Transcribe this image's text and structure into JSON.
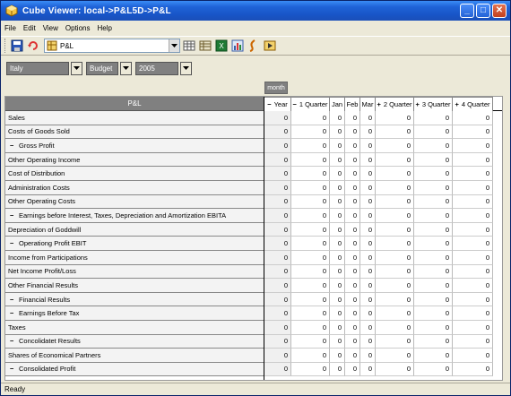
{
  "window": {
    "title": "Cube Viewer:  local->P&L5D->P&L",
    "controls": [
      "minimize",
      "maximize",
      "close"
    ]
  },
  "menu": [
    {
      "label": "File",
      "accel": "F"
    },
    {
      "label": "Edit",
      "accel": "E"
    },
    {
      "label": "View",
      "accel": "V"
    },
    {
      "label": "Options",
      "accel": "O"
    },
    {
      "label": "Help",
      "accel": "H"
    }
  ],
  "toolbar": {
    "cube_selected": "P&L",
    "icons": [
      "save-icon",
      "refresh-icon",
      "cube-icon",
      "table-icon",
      "grid-icon",
      "excel-icon",
      "chart-icon",
      "rule-icon",
      "export-icon"
    ]
  },
  "dimensions": [
    {
      "value": "Italy",
      "name": "country-select"
    },
    {
      "value": "Budget",
      "name": "version-select"
    },
    {
      "value": "2005",
      "name": "year-select"
    }
  ],
  "column_dimension": "month",
  "row_dimension_title": "P&L",
  "columns": [
    {
      "label": "Year",
      "expanded": true,
      "prefix": "−"
    },
    {
      "label": "1 Quarter",
      "expanded": true,
      "prefix": "−"
    },
    {
      "label": "Jan",
      "prefix": ""
    },
    {
      "label": "Feb",
      "prefix": ""
    },
    {
      "label": "Mar",
      "prefix": ""
    },
    {
      "label": "2 Quarter",
      "prefix": "+"
    },
    {
      "label": "3 Quarter",
      "prefix": "+"
    },
    {
      "label": "4 Quarter",
      "prefix": "+"
    }
  ],
  "rows": [
    {
      "label": "Sales",
      "prefix": ""
    },
    {
      "label": "Costs of Goods Sold",
      "prefix": ""
    },
    {
      "label": "Gross Profit",
      "prefix": "−"
    },
    {
      "label": "Other Operating Income",
      "prefix": ""
    },
    {
      "label": "Cost of Distribution",
      "prefix": ""
    },
    {
      "label": "Administration Costs",
      "prefix": ""
    },
    {
      "label": "Other Operating Costs",
      "prefix": ""
    },
    {
      "label": "Earnings before Interest, Taxes, Depreciation and Amortization EBITA",
      "prefix": "−"
    },
    {
      "label": "Depreciation of Goddwill",
      "prefix": ""
    },
    {
      "label": "Operationg Profit EBIT",
      "prefix": "−"
    },
    {
      "label": "Income from Participations",
      "prefix": ""
    },
    {
      "label": "Net Income Profit/Loss",
      "prefix": ""
    },
    {
      "label": "Other Financial Results",
      "prefix": ""
    },
    {
      "label": "Financial Results",
      "prefix": "−"
    },
    {
      "label": "Earnings Before Tax",
      "prefix": "−"
    },
    {
      "label": "Taxes",
      "prefix": ""
    },
    {
      "label": "Concolidatet Results",
      "prefix": "−"
    },
    {
      "label": "Shares of Economical Partners",
      "prefix": ""
    },
    {
      "label": "Consolidated Profit",
      "prefix": "−"
    }
  ],
  "cell_value": "0",
  "status": "Ready"
}
